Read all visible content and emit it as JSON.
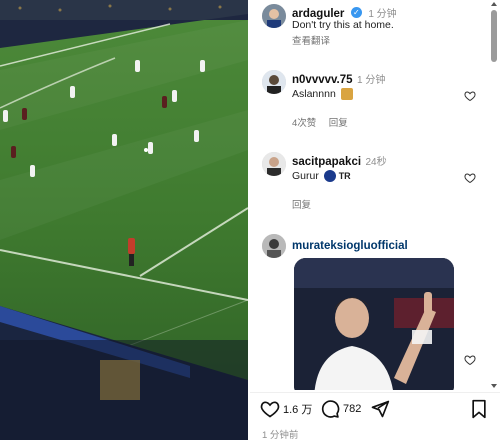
{
  "post": {
    "author": "ardaguler",
    "time": "1 分钟",
    "caption": "Don't try this at home.",
    "translate": "查看翻译"
  },
  "comments": [
    {
      "username": "n0vvvvv.75",
      "time": "1 分钟",
      "text": "Aslannnn",
      "emoji": "lion-face-icon",
      "likes": "4次赞",
      "reply": "回复"
    },
    {
      "username": "sacitpapakci",
      "time": "24秒",
      "text": "Gurur",
      "badge_text": "TR",
      "reply": "回复"
    },
    {
      "username": "murateksioglu",
      "username_suffix": "official"
    }
  ],
  "actions": {
    "likes": "1.6 万",
    "comments": "782"
  },
  "footer_time": "1 分钟前",
  "colors": {
    "pitch": "#3f7a2f",
    "link": "#00376b",
    "verified": "#3897f0"
  }
}
